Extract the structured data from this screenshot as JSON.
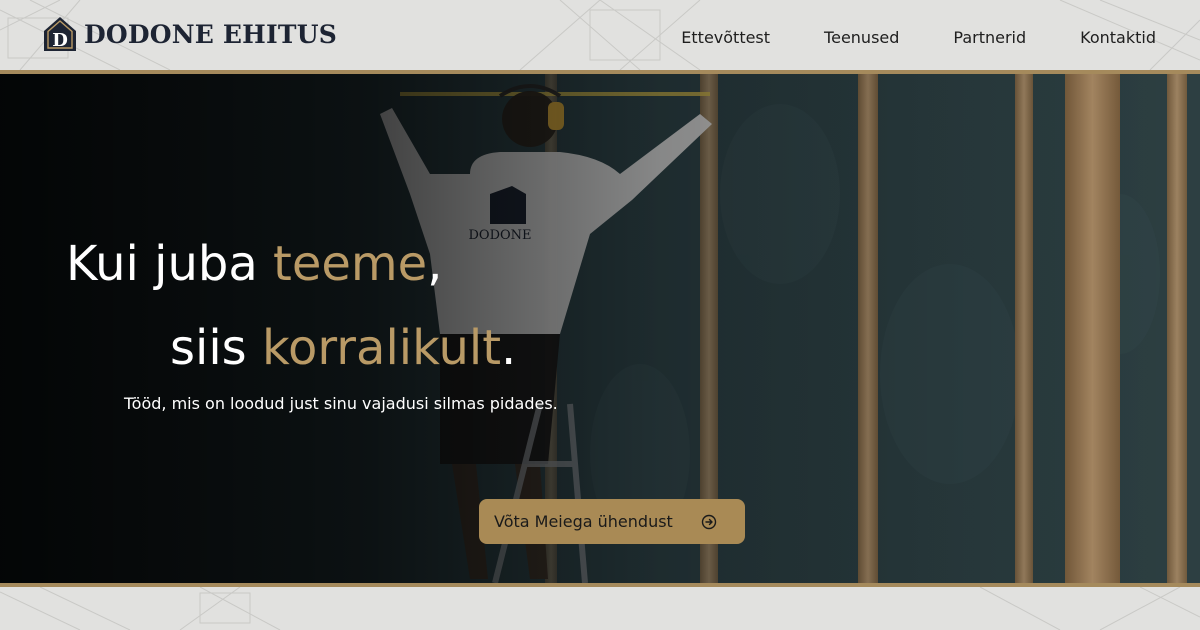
{
  "brand": {
    "name": "DODONE EHITUS",
    "logo_icon": "house-d-logo-icon",
    "colors": {
      "navy": "#1d2433",
      "gold": "#b99a66"
    }
  },
  "nav": {
    "items": [
      {
        "label": "Ettevõttest"
      },
      {
        "label": "Teenused"
      },
      {
        "label": "Partnerid"
      },
      {
        "label": "Kontaktid"
      }
    ]
  },
  "hero": {
    "headline": {
      "line1_prefix": "Kui juba ",
      "line1_accent": "teeme",
      "line1_suffix": ",",
      "line2_prefix": "siis ",
      "line2_accent": "korralikult",
      "line2_suffix": "."
    },
    "subtext": "Tööd, mis on loodud just sinu vajadusi silmas pidades.",
    "cta": {
      "label": "Võta Meiega ühendust",
      "icon": "arrow-right-circle-icon"
    },
    "background_image": "construction-worker-measuring-wall-photo",
    "accent_color": "#a98a55"
  }
}
